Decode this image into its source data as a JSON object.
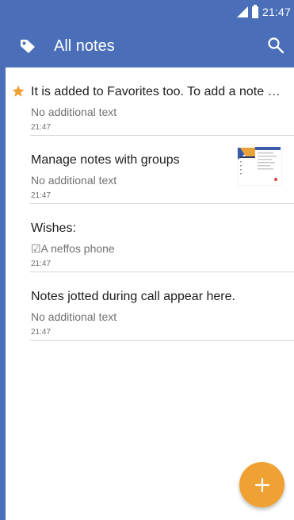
{
  "status_bar": {
    "time": "21:47",
    "signal_icon": "cell-signal-icon",
    "battery_icon": "battery-icon"
  },
  "app_bar": {
    "title": "All notes",
    "left_icon": "tag-icon",
    "right_icon": "search-icon",
    "color": "#4a6fb8"
  },
  "notes": [
    {
      "title": "It is added to Favorites too. To add a note to Favorites, tap the star icon",
      "subtitle": "No additional text",
      "time": "21:47",
      "favorite": true,
      "has_thumbnail": false
    },
    {
      "title": "Manage notes with groups",
      "subtitle": "No additional text",
      "time": "21:47",
      "favorite": false,
      "has_thumbnail": true
    },
    {
      "title": "Wishes:",
      "subtitle": "☑A neffos phone",
      "time": "21:47",
      "favorite": false,
      "has_thumbnail": false
    },
    {
      "title": "Notes jotted during call appear here.",
      "subtitle": "No additional text",
      "time": "21:47",
      "favorite": false,
      "has_thumbnail": false
    }
  ],
  "fab": {
    "icon": "plus-icon",
    "color": "#f0a133"
  },
  "colors": {
    "star": "#f0a133",
    "divider": "#d6d6d6"
  }
}
